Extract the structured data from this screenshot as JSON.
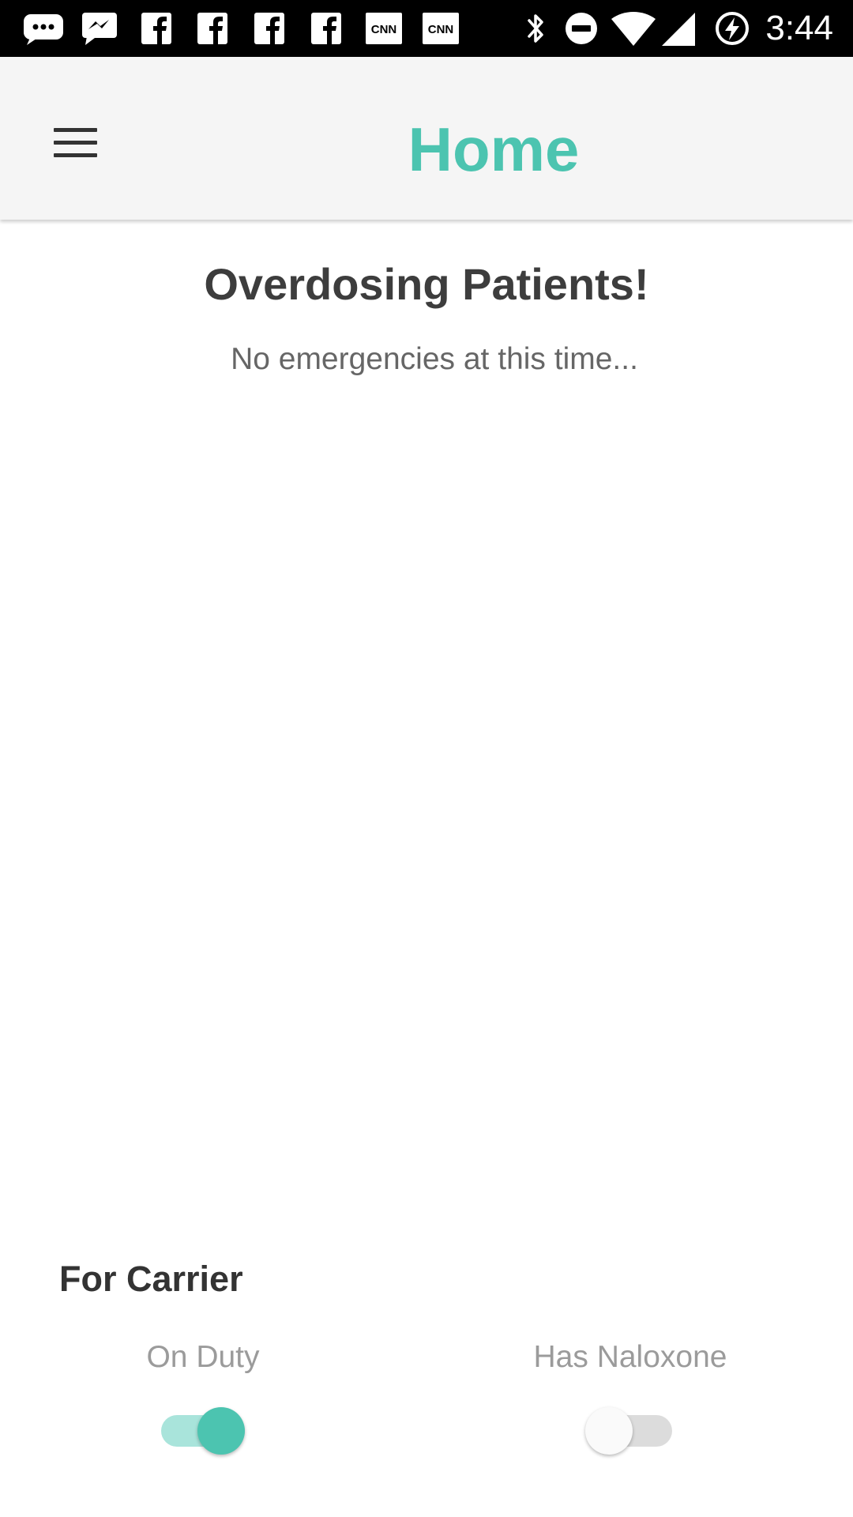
{
  "status_bar": {
    "time": "3:44",
    "notification_icons": [
      "messages-icon",
      "messenger-icon",
      "facebook-icon",
      "facebook-icon",
      "facebook-icon",
      "facebook-icon",
      "cnn-icon",
      "cnn-icon"
    ],
    "cnn_label": "CNN",
    "system_icons": [
      "bluetooth-icon",
      "do-not-disturb-icon",
      "wifi-icon",
      "signal-icon",
      "battery-charging-icon"
    ]
  },
  "header": {
    "title": "Home",
    "menu_icon": "hamburger-menu-icon"
  },
  "main": {
    "heading": "Overdosing Patients!",
    "empty_message": "No emergencies at this time..."
  },
  "carrier": {
    "title": "For Carrier",
    "toggles": [
      {
        "label": "On Duty",
        "checked": true
      },
      {
        "label": "Has Naloxone",
        "checked": false
      }
    ]
  },
  "colors": {
    "accent": "#4cc4b0",
    "accent_light": "#a9e4db",
    "toolbar_bg": "#f5f5f5",
    "heading_text": "#3d3d3d",
    "muted_text": "#9b9b9b"
  }
}
